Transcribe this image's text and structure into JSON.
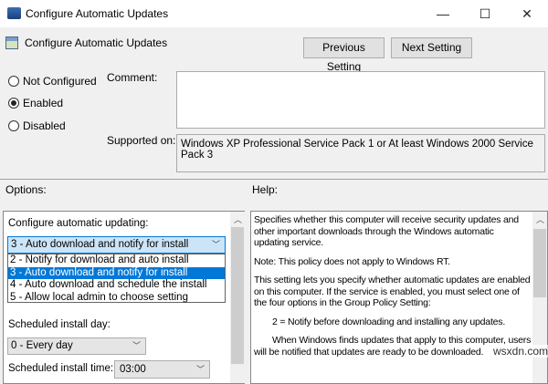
{
  "window": {
    "title": "Configure Automatic Updates",
    "minimize": "—",
    "maximize": "☐",
    "close": "✕"
  },
  "header": {
    "title": "Configure Automatic Updates",
    "prev": "Previous Setting",
    "next": "Next Setting"
  },
  "state": {
    "options": [
      {
        "label": "Not Configured",
        "selected": false
      },
      {
        "label": "Enabled",
        "selected": true
      },
      {
        "label": "Disabled",
        "selected": false
      }
    ]
  },
  "comment": {
    "label": "Comment:",
    "value": ""
  },
  "supported": {
    "label": "Supported on:",
    "value": "Windows XP Professional Service Pack 1 or At least Windows 2000 Service Pack 3"
  },
  "options_label": "Options:",
  "help_label": "Help:",
  "options": {
    "configure_label": "Configure automatic updating:",
    "configure_value": "3 - Auto download and notify for install",
    "configure_list": [
      "2 - Notify for download and auto install",
      "3 - Auto download and notify for install",
      "4 - Auto download and schedule the install",
      "5 - Allow local admin to choose setting"
    ],
    "day_label": "Scheduled install day:",
    "day_value": "0 - Every day",
    "time_label": "Scheduled install time:",
    "time_value": "03:00"
  },
  "help": {
    "paragraphs": [
      "Specifies whether this computer will receive security updates and other important downloads through the Windows automatic updating service.",
      "Note: This policy does not apply to Windows RT.",
      "This setting lets you specify whether automatic updates are enabled on this computer. If the service is enabled, you must select one of the four options in the Group Policy Setting:",
      "2 = Notify before downloading and installing any updates.",
      "When Windows finds updates that apply to this computer, users will be notified that updates are ready to be downloaded."
    ]
  },
  "watermark": "wsxdn.com",
  "colors": {
    "accent": "#0078d7",
    "dropdown_bg": "#cce4f7"
  }
}
